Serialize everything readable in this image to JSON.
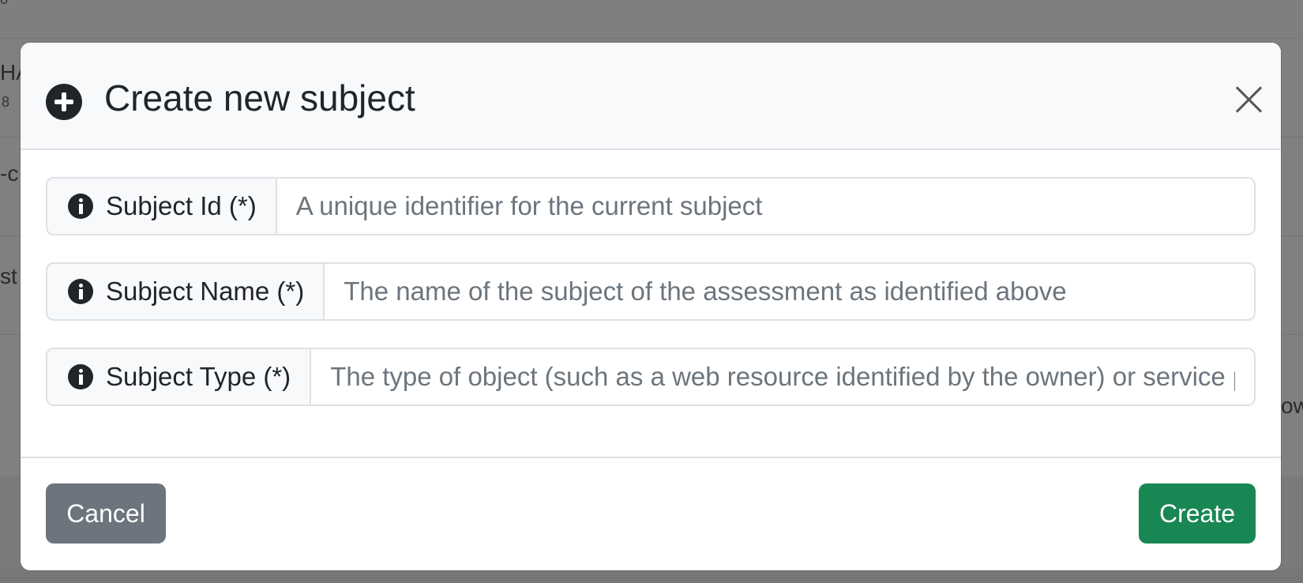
{
  "background": {
    "fragments": [
      "o",
      "HA",
      "8",
      "-c",
      "st",
      "ow"
    ]
  },
  "modal": {
    "header_icon": "plus-circle-icon",
    "title": "Create new subject",
    "close_icon": "close-icon"
  },
  "fields": [
    {
      "label": "Subject Id (*)",
      "icon": "info-circle-icon",
      "value": "",
      "placeholder": "A unique identifier for the current subject"
    },
    {
      "label": "Subject Name (*)",
      "icon": "info-circle-icon",
      "value": "",
      "placeholder": "The name of the subject of the assessment as identified above"
    },
    {
      "label": "Subject Type (*)",
      "icon": "info-circle-icon",
      "value": "",
      "placeholder": "The type of object (such as a web resource identified by the owner) or service provided"
    }
  ],
  "footer": {
    "cancel_label": "Cancel",
    "create_label": "Create"
  },
  "colors": {
    "overlay": "#7f7f7f",
    "cancel": "#6c757d",
    "create": "#198754",
    "header_bg": "#f8f9fa",
    "border": "#dee2e6"
  }
}
